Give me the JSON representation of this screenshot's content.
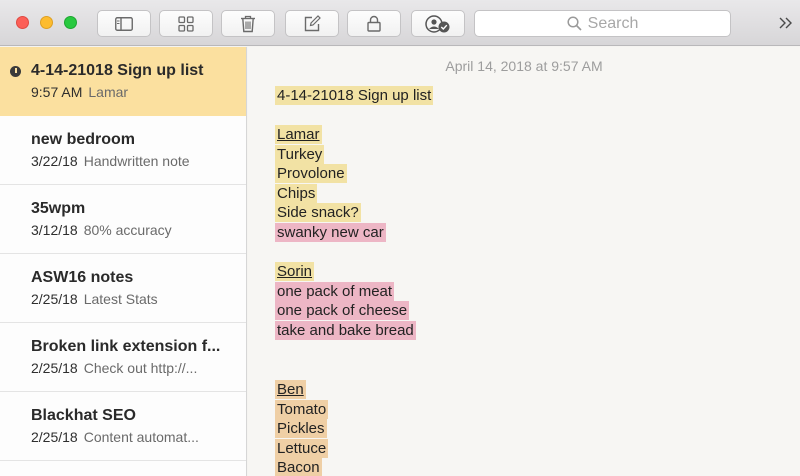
{
  "window": {
    "search_placeholder": "Search"
  },
  "notes": [
    {
      "title": "4-14-21018 Sign up list",
      "date": "9:57 AM",
      "snippet": "Lamar"
    },
    {
      "title": "new bedroom",
      "date": "3/22/18",
      "snippet": "Handwritten note"
    },
    {
      "title": "35wpm",
      "date": "3/12/18",
      "snippet": "80% accuracy"
    },
    {
      "title": "ASW16 notes",
      "date": "2/25/18",
      "snippet": "Latest Stats"
    },
    {
      "title": "Broken link extension f...",
      "date": "2/25/18",
      "snippet": "Check out http://..."
    },
    {
      "title": "Blackhat SEO",
      "date": "2/25/18",
      "snippet": "Content automat..."
    }
  ],
  "editor": {
    "timestamp": "April 14, 2018 at 9:57 AM",
    "lines": [
      "4-14-21018 Sign up list",
      "Lamar",
      "Turkey",
      "Provolone",
      "Chips",
      "Side snack?",
      "swanky new car",
      "Sorin",
      "one pack of meat",
      "one pack of cheese",
      "take and bake bread",
      "Ben",
      "Tomato",
      "Pickles",
      "Lettuce",
      "Bacon"
    ]
  },
  "highlight_colors": {
    "yellow": "#f2e2a4",
    "pink": "#edb6c5",
    "orange": "#efcfa5",
    "selected_note": "#fbe09f"
  }
}
